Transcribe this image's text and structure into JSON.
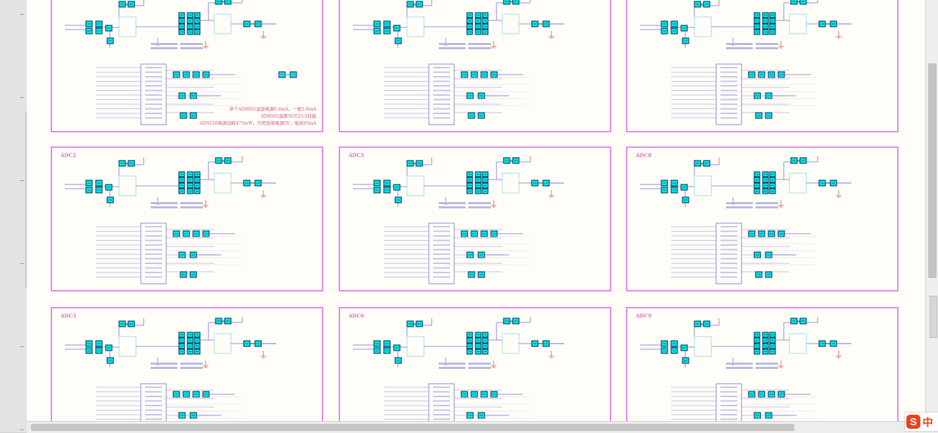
{
  "sheets": [
    {
      "label": "",
      "notes": [
        "单个AD8065运放电源6.4mA，一般5.8mA",
        "AD8065选用SOT23-5封装",
        "ADS126电源功耗475mW，只考虑单电源5V，电流95mA"
      ]
    },
    {
      "label": "",
      "notes": []
    },
    {
      "label": "",
      "notes": []
    },
    {
      "label": "ADC2",
      "notes": []
    },
    {
      "label": "ADC5",
      "notes": []
    },
    {
      "label": "ADC8",
      "notes": []
    },
    {
      "label": "ADC3",
      "notes": []
    },
    {
      "label": "ADC6",
      "notes": []
    },
    {
      "label": "ADC9",
      "notes": []
    }
  ],
  "input_method": {
    "logo": "S",
    "mode": "中"
  },
  "colors": {
    "canvas": "#fffdf7",
    "sheet_border": "#e38be6",
    "wire": "#6c6cd8",
    "component": "#00e5e8",
    "ic_body": "#9fe0ea",
    "power": "#c25a5a"
  }
}
